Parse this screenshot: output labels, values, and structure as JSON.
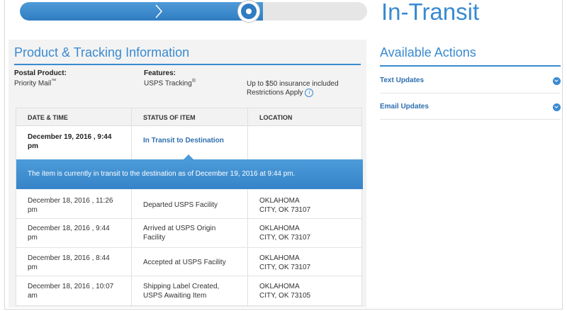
{
  "status": {
    "title": "In-Transit",
    "progress_fraction": 0.7
  },
  "product": {
    "section_title": "Product & Tracking Information",
    "postal_product_label": "Postal Product:",
    "postal_product_value": "Priority Mail",
    "postal_product_tm": "™",
    "features_label": "Features:",
    "features_value": "USPS Tracking",
    "features_reg": "®",
    "insurance_text": "Up to $50 insurance included",
    "restrictions_text": "Restrictions Apply",
    "info_icon": "i"
  },
  "table": {
    "headers": [
      "DATE & TIME",
      "STATUS OF ITEM",
      "LOCATION"
    ],
    "latest": {
      "date_line1": "December 19, 2016 , 9:44",
      "date_line2": "pm",
      "status": "In Transit to Destination",
      "location": ""
    },
    "callout": "The item is currently in transit to the destination as of December 19, 2016 at 9:44 pm.",
    "rows": [
      {
        "date_line1": "December 18, 2016 , 11:26",
        "date_line2": "pm",
        "status_line1": "Departed USPS Facility",
        "status_line2": "",
        "loc_line1": "OKLAHOMA",
        "loc_line2": "CITY, OK 73107"
      },
      {
        "date_line1": "December 18, 2016 , 9:44",
        "date_line2": "pm",
        "status_line1": "Arrived at USPS Origin",
        "status_line2": "Facility",
        "loc_line1": "OKLAHOMA",
        "loc_line2": "CITY, OK 73107"
      },
      {
        "date_line1": "December 18, 2016 , 8:44",
        "date_line2": "pm",
        "status_line1": "Accepted at USPS Facility",
        "status_line2": "",
        "loc_line1": "OKLAHOMA",
        "loc_line2": "CITY, OK 73107"
      },
      {
        "date_line1": "December 18, 2016 , 10:07",
        "date_line2": "am",
        "status_line1": "Shipping Label Created,",
        "status_line2": "USPS Awaiting Item",
        "loc_line1": "OKLAHOMA",
        "loc_line2": "CITY, OK 73105"
      }
    ]
  },
  "actions": {
    "title": "Available Actions",
    "items": [
      {
        "label": "Text Updates",
        "icon": "chevron-down-icon"
      },
      {
        "label": "Email Updates",
        "icon": "chevron-down-icon"
      }
    ]
  },
  "colors": {
    "accent": "#3a8ad0",
    "callout": "#3684c8"
  }
}
